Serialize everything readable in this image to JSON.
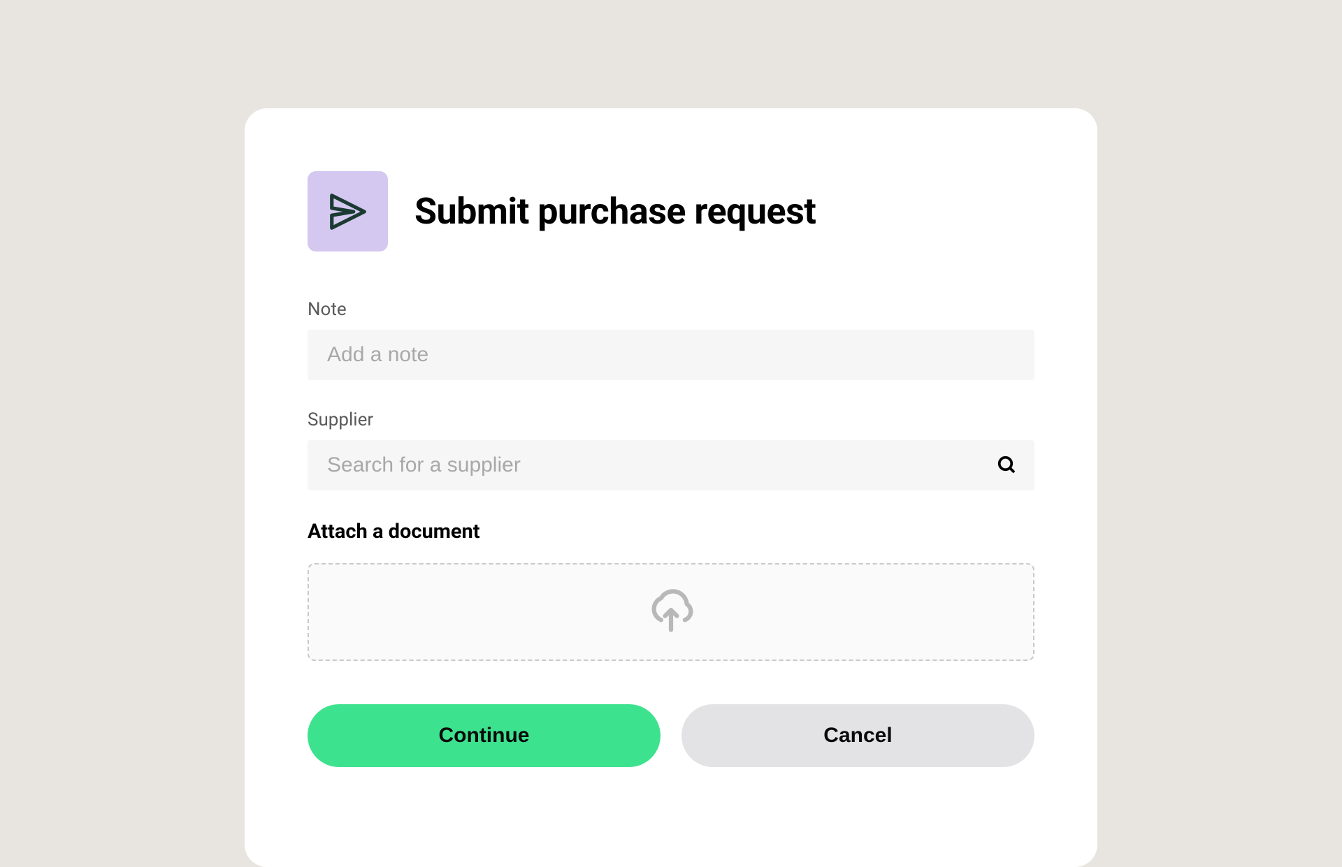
{
  "modal": {
    "title": "Submit purchase request",
    "fields": {
      "note": {
        "label": "Note",
        "placeholder": "Add a note",
        "value": ""
      },
      "supplier": {
        "label": "Supplier",
        "placeholder": "Search for a supplier",
        "value": ""
      }
    },
    "attach": {
      "title": "Attach a document"
    },
    "buttons": {
      "continue": "Continue",
      "cancel": "Cancel"
    }
  }
}
